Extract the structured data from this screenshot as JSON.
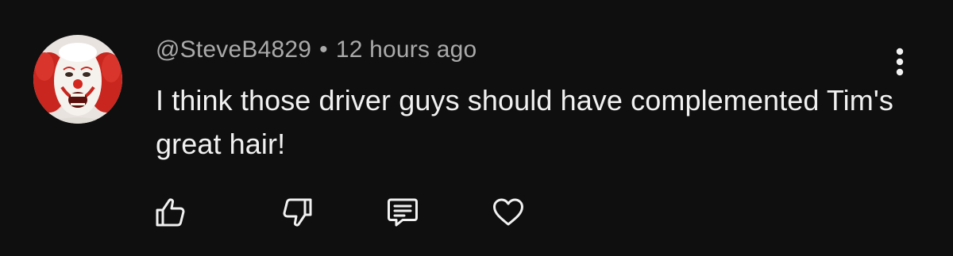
{
  "comment": {
    "author": "@SteveB4829",
    "separator": "•",
    "timestamp": "12 hours ago",
    "text": "I think those driver guys should have complemented Tim's great hair!",
    "avatar_icon": "clown-avatar",
    "more_icon": "more-vertical-icon"
  },
  "actions": {
    "like_icon": "thumbs-up-icon",
    "dislike_icon": "thumbs-down-icon",
    "reply_icon": "reply-comment-icon",
    "heart_icon": "heart-icon"
  },
  "colors": {
    "background": "#0f0f0f",
    "primary_text": "#f1f1f1",
    "secondary_text": "#aaaaaa"
  }
}
